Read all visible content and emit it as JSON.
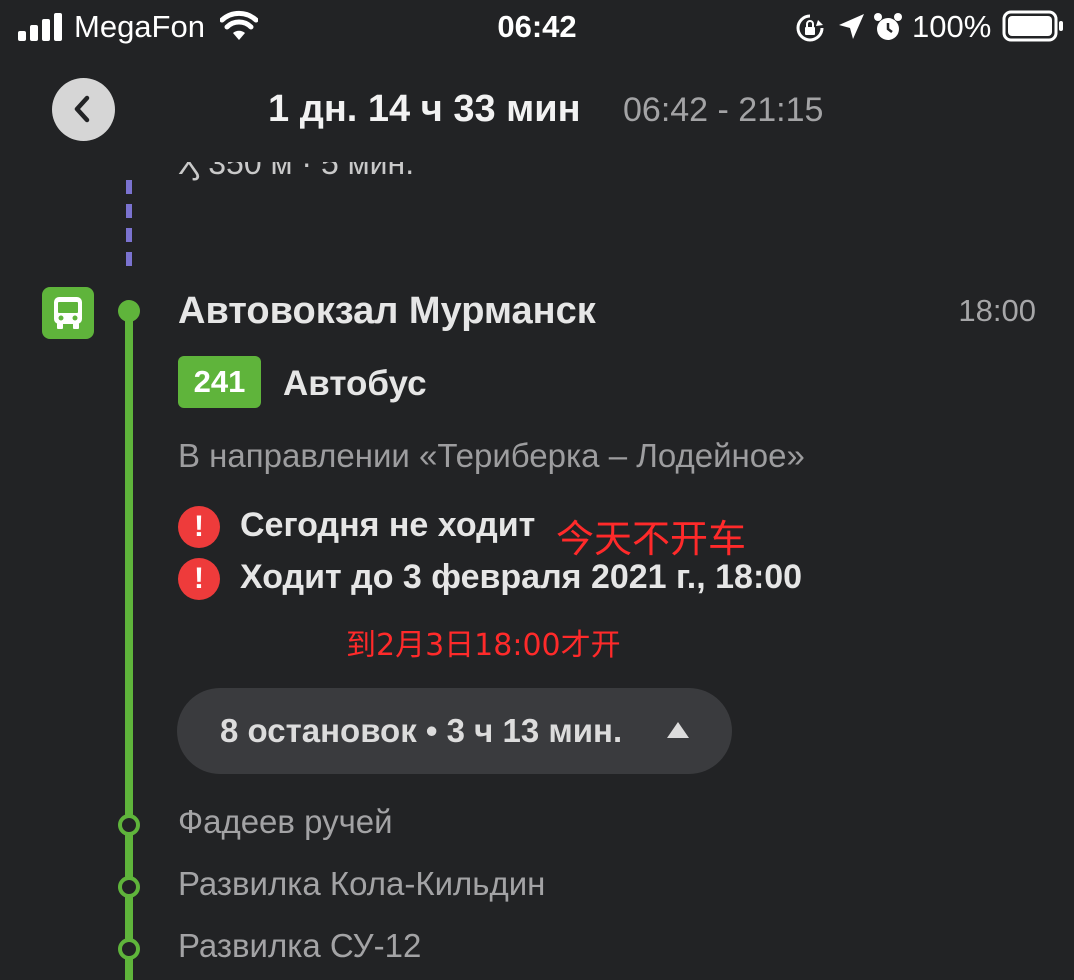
{
  "status_bar": {
    "carrier": "MegaFon",
    "time": "06:42",
    "battery": "100%"
  },
  "header": {
    "duration": "1 дн. 14 ч 33 мин",
    "timespan": "06:42 - 21:15"
  },
  "cutoff_text": "Ӽ 350 м · 5 мин.",
  "segment": {
    "stop_name": "Автовокзал Мурманск",
    "departure_time": "18:00",
    "route_number": "241",
    "transport_type": "Автобус",
    "direction": "В направлении «Териберка – Лодейное»",
    "alerts": [
      {
        "icon": "!",
        "text": "Сегодня не ходит"
      },
      {
        "icon": "!",
        "text": "Ходит до 3 февраля 2021 г., 18:00"
      }
    ],
    "stops_toggle_label": "8 остановок • 3 ч 13 мин.",
    "intermediate_stops": [
      "Фадеев ручей",
      "Развилка Кола-Кильдин",
      "Развилка СУ-12"
    ]
  },
  "annotations": {
    "note_1": "今天不开车",
    "note_2": "到2月3日18:00才开"
  },
  "colors": {
    "background": "#222325",
    "route_green": "#5fb43b",
    "walk_purple": "#7b73d0",
    "alert_red": "#ee3b3b",
    "annotation_red": "#ff2a2a"
  },
  "icons": {
    "back": "chevron-left-icon",
    "bus": "bus-icon",
    "alert": "exclamation-icon",
    "toggle": "caret-up-icon"
  }
}
